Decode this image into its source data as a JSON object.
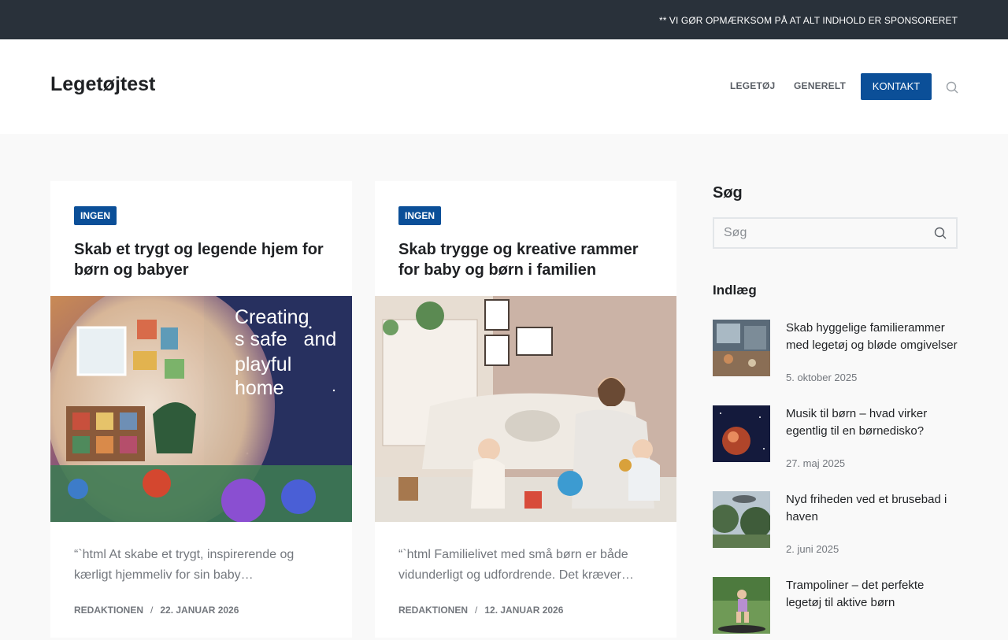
{
  "topbar": {
    "notice": "** VI GØR OPMÆRKSOM PÅ AT ALT INDHOLD ER SPONSORERET"
  },
  "header": {
    "logo": "Legetøjtest",
    "nav": [
      {
        "label": "LEGETØJ"
      },
      {
        "label": "GENERELT"
      },
      {
        "label": "KONTAKT"
      }
    ],
    "search_icon": "search-icon"
  },
  "posts": [
    {
      "category": "INGEN",
      "title": "Skab et trygt og legende hjem for børn og babyer",
      "image_text": [
        "Creating",
        "s safe   and",
        "playful",
        "home"
      ],
      "excerpt": "“`html At skabe et trygt, inspirerende og kærligt hjemmeliv for sin baby…",
      "author": "REDAKTIONEN",
      "date": "22. JANUAR 2026"
    },
    {
      "category": "INGEN",
      "title": "Skab trygge og kreative rammer for baby og børn i familien",
      "excerpt": "“`html Familielivet med små børn er både vidunderligt og udfordrende. Det kræver…",
      "author": "REDAKTIONEN",
      "date": "12. JANUAR 2026"
    }
  ],
  "sidebar": {
    "search_heading": "Søg",
    "search_placeholder": "Søg",
    "posts_heading": "Indlæg",
    "recent": [
      {
        "title": "Skab hyggelige familierammer med legetøj og bløde omgivelser",
        "date": "5. oktober 2025"
      },
      {
        "title": "Musik til børn – hvad virker egentlig til en børnedisko?",
        "date": "27. maj 2025"
      },
      {
        "title": "Nyd friheden ved et brusebad i haven",
        "date": "2. juni 2025"
      },
      {
        "title": "Trampoliner – det perfekte legetøj til aktive børn",
        "date": ""
      }
    ]
  },
  "colors": {
    "accent": "#0b4f98",
    "topbar": "#29313a",
    "background": "#f9f9f9"
  }
}
